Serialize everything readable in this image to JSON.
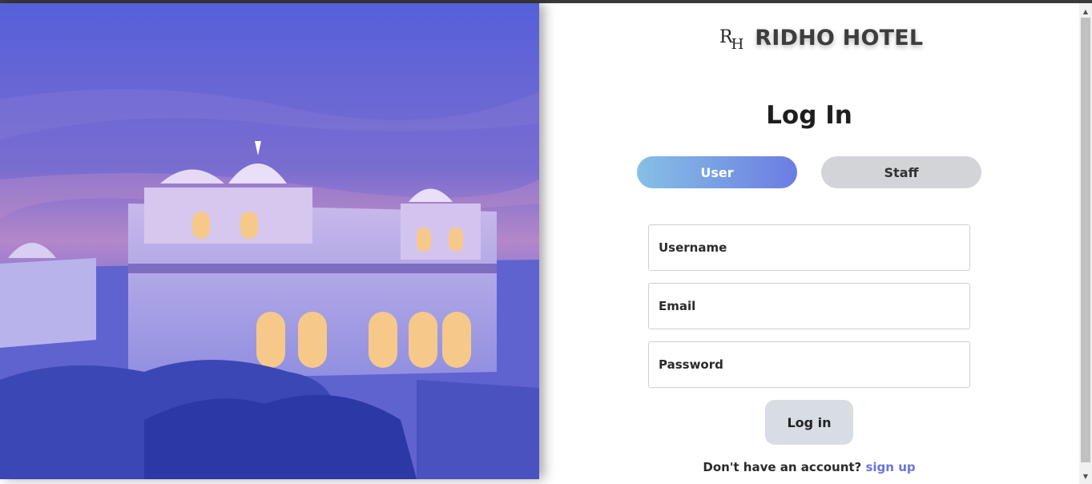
{
  "brand": {
    "logo_mark_1": "R",
    "logo_mark_2": "H",
    "name": "RIDHO HOTEL"
  },
  "login": {
    "title": "Log In",
    "tabs": [
      {
        "label": "User",
        "active": true
      },
      {
        "label": "Staff",
        "active": false
      }
    ],
    "fields": {
      "username_placeholder": "Username",
      "email_placeholder": "Email",
      "password_placeholder": "Password"
    },
    "submit_label": "Log in",
    "signup_prompt": "Don't have an account?",
    "signup_link": "sign up"
  },
  "colors": {
    "accent": "#6b73e0",
    "tab_active_start": "#86c0e6",
    "tab_active_end": "#6b7de2",
    "tab_inactive": "#d3d4d8",
    "button_bg": "#d8dce3"
  },
  "icons": {
    "scroll_up": "scroll-up-arrow-icon",
    "scroll_down": "scroll-down-arrow-icon"
  }
}
